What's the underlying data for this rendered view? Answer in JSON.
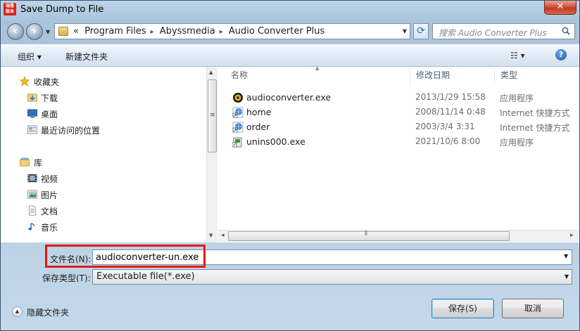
{
  "window": {
    "title": "Save Dump to File",
    "close_label": "✕"
  },
  "app_logo": {
    "text": "瑞雪 版本"
  },
  "address": {
    "crumbs": [
      "«",
      "Program Files",
      "Abyssmedia",
      "Audio Converter Plus"
    ]
  },
  "search": {
    "placeholder": "搜索 Audio Converter Plus"
  },
  "toolbar": {
    "organize": "组织 ▾",
    "new_folder": "新建文件夹",
    "view": "☷ ▾",
    "help": "?"
  },
  "nav": {
    "favorites": "收藏夹",
    "downloads": "下载",
    "desktop": "桌面",
    "recent": "最近访问的位置",
    "libraries": "库",
    "videos": "视频",
    "pictures": "图片",
    "documents": "文档",
    "music": "音乐"
  },
  "columns": {
    "name": "名称",
    "date": "修改日期",
    "type": "类型"
  },
  "files": [
    {
      "name": "audioconverter.exe",
      "date": "2013/1/29 15:58",
      "type": "应用程序",
      "icon": "app-exe-icon"
    },
    {
      "name": "home",
      "date": "2008/11/14 0:48",
      "type": "Internet 快捷方式",
      "icon": "internet-shortcut-icon"
    },
    {
      "name": "order",
      "date": "2003/3/4 3:31",
      "type": "Internet 快捷方式",
      "icon": "internet-shortcut-icon"
    },
    {
      "name": "unins000.exe",
      "date": "2021/10/6 8:00",
      "type": "应用程序",
      "icon": "uninstaller-icon"
    }
  ],
  "form": {
    "filename_label": "文件名(N):",
    "filename_value": "audioconverter-un.exe",
    "filetype_label": "保存类型(T):",
    "filetype_value": "Executable file(*.exe)"
  },
  "footer": {
    "hide_folders": "隐藏文件夹",
    "save": "保存(S)",
    "cancel": "取消"
  },
  "colors": {
    "accent": "#3c7fb1",
    "highlight": "#e41a1a"
  }
}
